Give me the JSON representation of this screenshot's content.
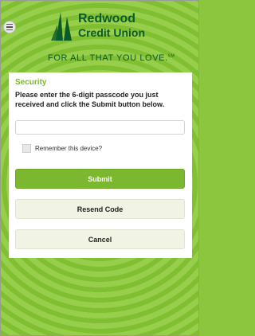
{
  "brand": {
    "name_line1": "Redwood",
    "name_line2": "Credit Union",
    "tagline": "FOR ALL THAT YOU LOVE.",
    "tagline_mark": "SM",
    "color": "#0b5a2a"
  },
  "menu": {
    "icon": "hamburger-icon"
  },
  "security": {
    "title": "Security",
    "instructions": "Please enter the 6-digit passcode you just received and click the Submit button below.",
    "code_value": "",
    "remember_label": "Remember this device?",
    "remember_checked": false
  },
  "buttons": {
    "submit": "Submit",
    "resend": "Resend Code",
    "cancel": "Cancel"
  },
  "colors": {
    "accent": "#7cb82f",
    "background": "#8cc63f",
    "secondary_button": "#f1f4e4"
  }
}
